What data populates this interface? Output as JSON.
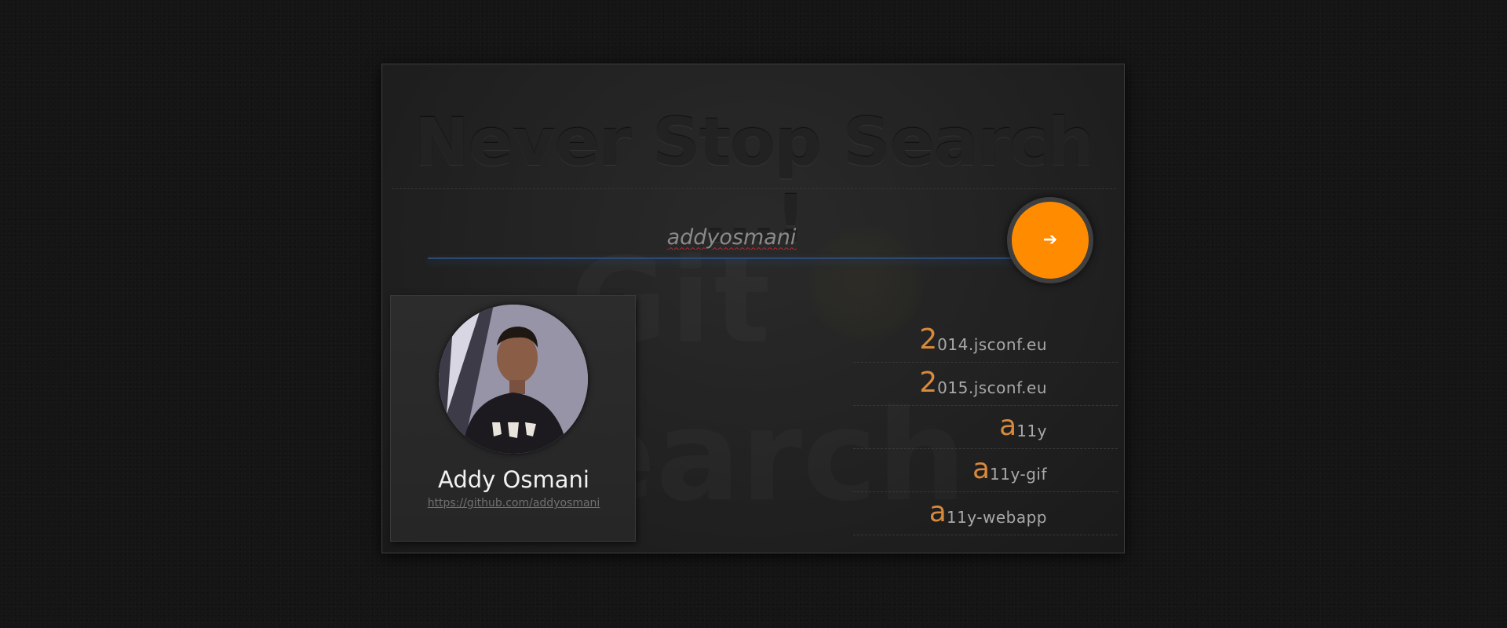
{
  "title": "Never Stop Search ...!",
  "search": {
    "value": "addyosmani"
  },
  "go_button": {
    "icon": "arrow-right-icon",
    "glyph": "➔",
    "color": "#ff8c00"
  },
  "profile": {
    "name": "Addy Osmani",
    "url": "https://github.com/addyosmani"
  },
  "repos": [
    {
      "first": "2",
      "rest": "014.jsconf.eu"
    },
    {
      "first": "2",
      "rest": "015.jsconf.eu"
    },
    {
      "first": "a",
      "rest": "11y"
    },
    {
      "first": "a",
      "rest": "11y-gif"
    },
    {
      "first": "a",
      "rest": "11y-webapp"
    }
  ],
  "colors": {
    "accent": "#ff8c00",
    "repo_initial": "#d9893a",
    "background": "#151515"
  }
}
